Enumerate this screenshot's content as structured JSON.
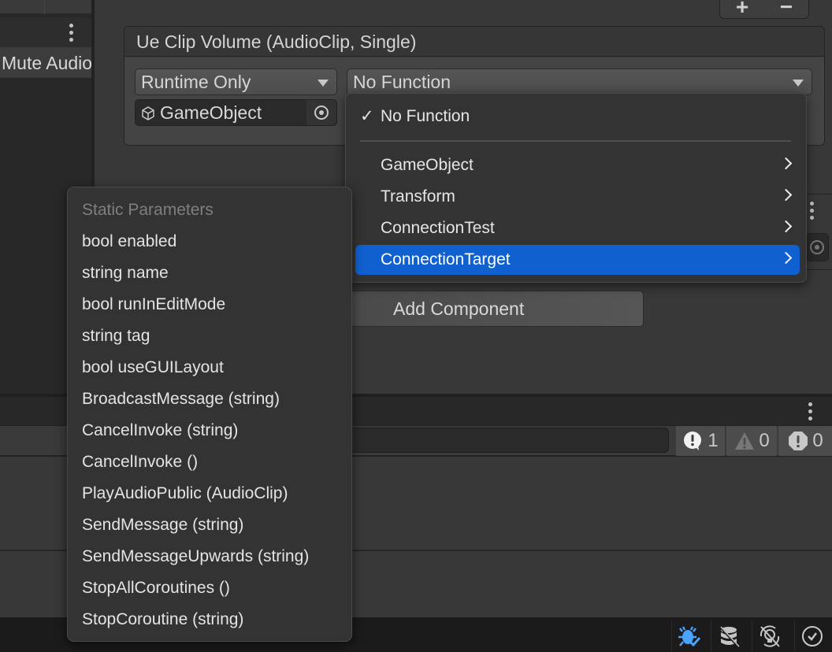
{
  "left_panel": {
    "row_label": "Mute Audio"
  },
  "inspector": {
    "list_add_label": "+",
    "list_remove_label": "−",
    "event_title": "Ue Clip Volume (AudioClip, Single)",
    "call_state": {
      "selected": "Runtime Only"
    },
    "function": {
      "selected": "No Function"
    },
    "target_object": {
      "value": "GameObject",
      "icon": "cube-icon"
    },
    "add_component_label": "Add Component"
  },
  "function_menu": {
    "selected_item": {
      "label": "No Function",
      "checked": true
    },
    "items": [
      {
        "label": "GameObject",
        "has_submenu": true,
        "highlighted": false
      },
      {
        "label": "Transform",
        "has_submenu": true,
        "highlighted": false
      },
      {
        "label": "ConnectionTest",
        "has_submenu": true,
        "highlighted": false
      },
      {
        "label": "ConnectionTarget",
        "has_submenu": true,
        "highlighted": true
      }
    ],
    "highlight_color": "#1160cf"
  },
  "sub_menu": {
    "header": "Static Parameters",
    "items": [
      "bool enabled",
      "string name",
      "bool runInEditMode",
      "string tag",
      "bool useGUILayout",
      "BroadcastMessage (string)",
      "CancelInvoke (string)",
      "CancelInvoke ()",
      "PlayAudioPublic (AudioClip)",
      "SendMessage (string)",
      "SendMessageUpwards (string)",
      "StopAllCoroutines ()",
      "StopCoroutine (string)"
    ]
  },
  "console": {
    "search_value": "",
    "log_count": "1",
    "warning_count": "0",
    "error_count": "0"
  },
  "status_bar": {
    "icons": [
      "debug-mode-icon",
      "cache-server-disabled-icon",
      "auto-gi-disabled-icon",
      "check-circle-icon"
    ],
    "accent_color": "#4aa3ff"
  }
}
